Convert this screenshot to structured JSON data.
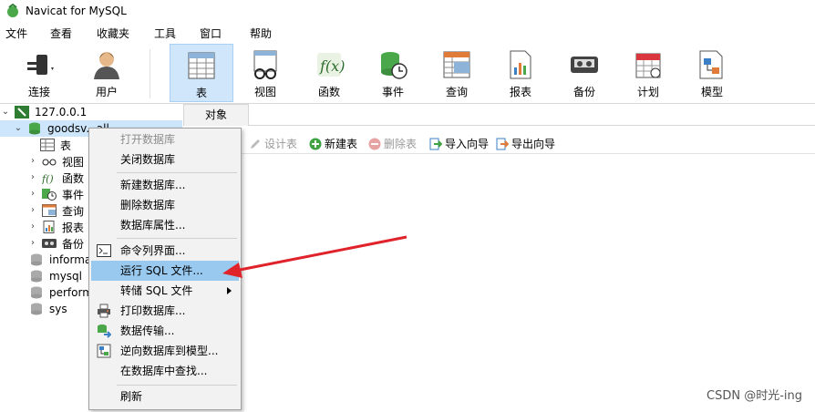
{
  "window": {
    "title": "Navicat for MySQL"
  },
  "menu": [
    "文件",
    "查看",
    "收藏夹",
    "工具",
    "窗口",
    "帮助"
  ],
  "toolbar": {
    "connect": "连接",
    "user": "用户",
    "buttons": [
      "表",
      "视图",
      "函数",
      "事件",
      "查询",
      "报表",
      "备份",
      "计划",
      "模型"
    ]
  },
  "tree": {
    "connection": "127.0.0.1",
    "database": "goodsv...all",
    "nodes": [
      "表",
      "视图",
      "函数",
      "事件",
      "查询",
      "报表",
      "备份"
    ],
    "other_dbs": [
      "informa",
      "mysql",
      "perform",
      "sys"
    ]
  },
  "object_tab": "对象",
  "object_tools": [
    "设计表",
    "新建表",
    "删除表",
    "导入向导",
    "导出向导"
  ],
  "context_menu": {
    "items": [
      "打开数据库",
      "关闭数据库",
      "新建数据库...",
      "删除数据库",
      "数据库属性...",
      "命令列界面...",
      "运行 SQL 文件...",
      "转储 SQL 文件",
      "打印数据库...",
      "数据传输...",
      "逆向数据库到模型...",
      "在数据库中查找...",
      "刷新"
    ],
    "highlighted": "运行 SQL 文件..."
  },
  "watermark": "CSDN @时光-ing",
  "colors": {
    "accent": "#cfe6fb",
    "highlight": "#99c9ef",
    "arrow": "#e0232b",
    "db_green": "#4aa84a"
  }
}
